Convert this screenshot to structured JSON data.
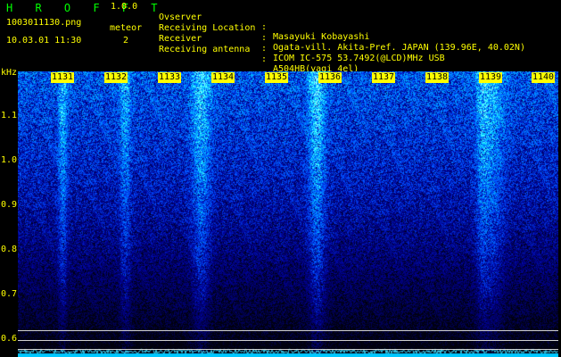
{
  "app": {
    "name": "H R O F F T",
    "version": "1.0.0",
    "file_name": "1003011130.png",
    "datetime": "10.03.01 11:30",
    "count_label": "meteor",
    "count_value": "2"
  },
  "info": [
    {
      "key": "Ovserver",
      "value": "Masayuki Kobayashi"
    },
    {
      "key": "Receiving Location",
      "value": "Ogata-vill. Akita-Pref. JAPAN (139.96E, 40.02N)"
    },
    {
      "key": "Receiver",
      "value": "ICOM IC-575 53.7492(@LCD)MHz USB"
    },
    {
      "key": "Receiving antenna",
      "value": "A504HB(yagi 4el)"
    }
  ],
  "info_colon": ":",
  "time_ticks": [
    "1131",
    "1132",
    "1133",
    "1134",
    "1135",
    "1136",
    "1137",
    "1138",
    "1139",
    "1140"
  ],
  "freq_axis": {
    "unit": "kHz",
    "labels": [
      "1.1",
      "1.0",
      "0.9",
      "0.8",
      "0.7",
      "0.6"
    ]
  },
  "colors": {
    "text": "#ffff00",
    "brand": "#00ff00",
    "background": "#000000"
  }
}
